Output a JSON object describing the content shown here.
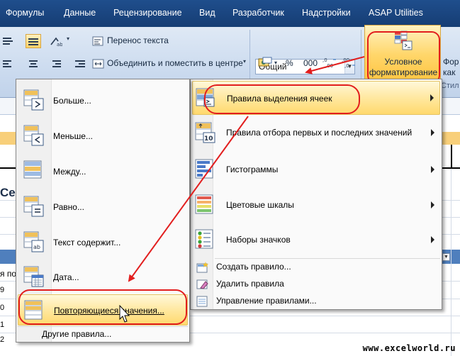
{
  "tabs": [
    "Формулы",
    "Данные",
    "Рецензирование",
    "Вид",
    "Разработчик",
    "Надстройки",
    "ASAP Utilities"
  ],
  "ribbon": {
    "wrap_text": "Перенос текста",
    "merge_center": "Объединить и поместить в центре",
    "number_format": "Общий",
    "percent": "%",
    "thousands": "000",
    "cf_label_line1": "Условное",
    "cf_label_line2": "форматирование",
    "format_fragment_1": "Фор",
    "format_fragment_2": "как",
    "styles_fragment": "Стил"
  },
  "sheet": {
    "fragment_se": "Се",
    "fragment_ya_po": "я по",
    "row_numbers": [
      "9",
      "0",
      "1",
      "2"
    ]
  },
  "main_menu": {
    "items": [
      {
        "label": "Правила выделения ячеек",
        "has_submenu": true
      },
      {
        "label": "Правила отбора первых и последних значений",
        "has_submenu": true
      },
      {
        "label": "Гистограммы",
        "has_submenu": true
      },
      {
        "label": "Цветовые шкалы",
        "has_submenu": true
      },
      {
        "label": "Наборы значков",
        "has_submenu": true
      }
    ],
    "small_items": [
      {
        "label": "Создать правило..."
      },
      {
        "label": "Удалить правила",
        "has_submenu": true
      },
      {
        "label": "Управление правилами..."
      }
    ]
  },
  "sub_menu": {
    "items": [
      {
        "label": "Больше..."
      },
      {
        "label": "Меньше..."
      },
      {
        "label": "Между..."
      },
      {
        "label": "Равно..."
      },
      {
        "label": "Текст содержит..."
      },
      {
        "label": "Дата..."
      },
      {
        "label": "Повторяющиеся значения..."
      }
    ],
    "other_rules": "Другие правила..."
  },
  "watermark": "www.excelworld.ru",
  "colors": {
    "highlight": "#ffe8a0",
    "annotation": "#e21e1e",
    "tabbar": "#1f4e8c"
  }
}
